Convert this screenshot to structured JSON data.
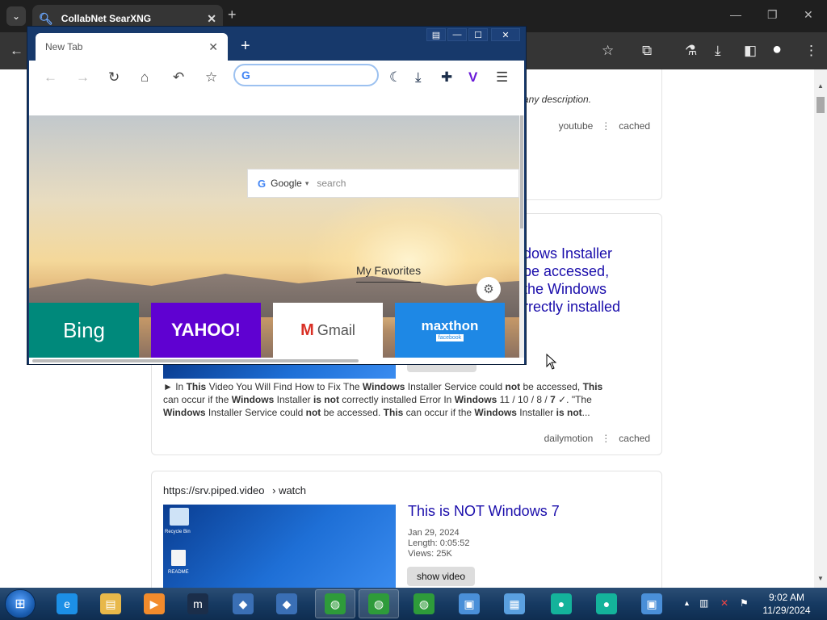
{
  "chrome": {
    "tab_title": "CollabNet SearXNG",
    "tab_favicon": "search-icon",
    "close_glyph": "✕",
    "new_tab_glyph": "+",
    "menu_glyph": "⌄",
    "controls": {
      "minimize": "—",
      "restore": "❐",
      "close": "✕"
    },
    "toolbar_icons": {
      "back": "←",
      "bookmark": "☆",
      "extensions": "⧉",
      "labs": "⚗",
      "download": "⤓",
      "sidebar": "◧",
      "profile": "●",
      "menu": "⋮"
    }
  },
  "results": [
    {
      "snippet_tail": "any description.",
      "source": "youtube",
      "cached": "cached"
    },
    {
      "title_lines": [
        "dows Installer",
        " be accessed,",
        "the Windows",
        "rrectly installed"
      ],
      "snippet_lines": [
        "► In This Video You Will Find How to Fix The Windows Installer Service could not be accessed, This",
        "can occur if the Windows Installer is not correctly installed Error In Windows 11 / 10 / 8 / 7 ✓. \"The",
        "Windows Installer Service could not be accessed. This can occur if the Windows Installer is not..."
      ],
      "source": "dailymotion",
      "cached": "cached"
    },
    {
      "url": "https://srv.piped.video",
      "url_path": "› watch",
      "title": "This is NOT Windows 7",
      "date": "Jan 29, 2024",
      "length": "Length: 0:05:52",
      "views": "Views: 25K",
      "button": "show video",
      "desktop_labels": [
        "Recycle Bin",
        "README"
      ]
    }
  ],
  "maxthon": {
    "tab_title": "New Tab",
    "tab_close": "✕",
    "new_tab": "+",
    "window_buttons": {
      "tabs": "▤",
      "minimize": "—",
      "maximize": "☐",
      "close": "✕"
    },
    "nav": {
      "back": "←",
      "forward": "→",
      "reload": "↻",
      "home": "⌂",
      "undo": "↶",
      "favorite": "☆"
    },
    "address_placeholder": "",
    "address_badge": "G",
    "toolbar_right": {
      "night": "☾",
      "download": "⤓",
      "extensions": "✚",
      "vivaldi": "V",
      "menu": "☰"
    },
    "search_engine": "Google",
    "search_engine_badge": "G",
    "search_caret": "▾",
    "search_placeholder": "search",
    "favorites_label": "My Favorites",
    "settings_glyph": "⚙",
    "tiles": [
      {
        "label": "Bing",
        "color": "#00897b",
        "text_color": "#ffffff"
      },
      {
        "label": "YAHOO!",
        "color": "#5f01d1",
        "text_color": "#ffffff"
      },
      {
        "label": "Gmail",
        "color": "#ffffff",
        "text_color": "#555555"
      },
      {
        "label": "maxthon",
        "color": "#1e88e5",
        "text_color": "#ffffff",
        "badge": "facebook"
      }
    ]
  },
  "taskbar": {
    "start_glyph": "⊞",
    "apps": [
      {
        "name": "ie-icon",
        "glyph": "e",
        "color": "#1c8fe6"
      },
      {
        "name": "explorer-icon",
        "glyph": "▤",
        "color": "#e8b84a"
      },
      {
        "name": "media-player-icon",
        "glyph": "▶",
        "color": "#f28b2c"
      },
      {
        "name": "maxthon-icon",
        "glyph": "m",
        "color": "#1b2e4a"
      },
      {
        "name": "virtualbox-icon",
        "glyph": "◆",
        "color": "#3a6fb5"
      },
      {
        "name": "virtualbox-icon-2",
        "glyph": "◆",
        "color": "#3a6fb5"
      },
      {
        "name": "globe-icon",
        "glyph": "◍",
        "color": "#2e9b3a"
      },
      {
        "name": "globe-icon-2",
        "glyph": "◍",
        "color": "#2e9b3a"
      },
      {
        "name": "globe-icon-3",
        "glyph": "◍",
        "color": "#2e9b3a"
      },
      {
        "name": "monitor-icon",
        "glyph": "▣",
        "color": "#4a8fd8"
      },
      {
        "name": "control-panel-icon",
        "glyph": "▦",
        "color": "#5aa0e0"
      },
      {
        "name": "teal-app-icon",
        "glyph": "●",
        "color": "#14b39b"
      },
      {
        "name": "teal-app-icon-2",
        "glyph": "●",
        "color": "#14b39b"
      },
      {
        "name": "monitor-icon-2",
        "glyph": "▣",
        "color": "#4a8fd8"
      }
    ],
    "tray": {
      "arrow": "▲",
      "network": "▥",
      "volume": "✕",
      "flag": "⚑"
    },
    "time": "9:02 AM",
    "date": "11/29/2024"
  }
}
